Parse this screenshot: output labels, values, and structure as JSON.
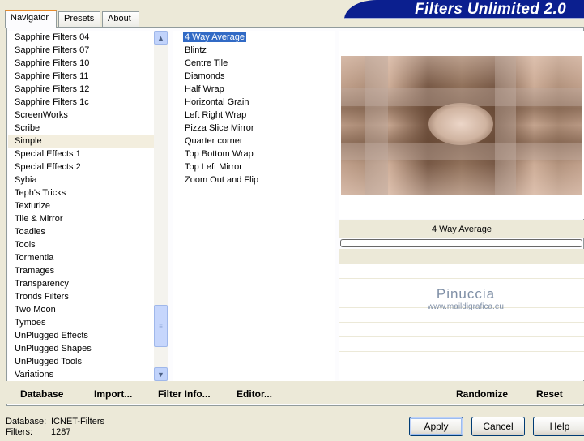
{
  "tabs": [
    "Navigator",
    "Presets",
    "About"
  ],
  "app_title": "Filters Unlimited 2.0",
  "categories": [
    "Sapphire Filters 04",
    "Sapphire Filters 07",
    "Sapphire Filters 10",
    "Sapphire Filters 11",
    "Sapphire Filters 12",
    "Sapphire Filters 1c",
    "ScreenWorks",
    "Scribe",
    "Simple",
    "Special Effects 1",
    "Special Effects 2",
    "Sybia",
    "Teph's Tricks",
    "Texturize",
    "Tile & Mirror",
    "Toadies",
    "Tools",
    "Tormentia",
    "Tramages",
    "Transparency",
    "Tronds Filters",
    "Two Moon",
    "Tymoes",
    "UnPlugged Effects",
    "UnPlugged Shapes",
    "UnPlugged Tools",
    "Variations"
  ],
  "selected_category": "Simple",
  "filters": [
    "4 Way Average",
    "Blintz",
    "Centre Tile",
    "Diamonds",
    "Half Wrap",
    "Horizontal Grain",
    "Left Right Wrap",
    "Pizza Slice Mirror",
    "Quarter corner",
    "Top Bottom Wrap",
    "Top Left Mirror",
    "Zoom Out and Flip"
  ],
  "selected_filter": "4 Way Average",
  "filter_name": "4 Way Average",
  "progress": 0,
  "watermark": {
    "name": "Pinuccia",
    "url": "www.maildigrafica.eu"
  },
  "links": {
    "database": "Database",
    "import": "Import...",
    "filter_info": "Filter Info...",
    "editor": "Editor...",
    "randomize": "Randomize",
    "reset": "Reset"
  },
  "status": {
    "database_label": "Database:",
    "database_value": "ICNET-Filters",
    "filters_label": "Filters:",
    "filters_value": "1287"
  },
  "buttons": {
    "apply": "Apply",
    "cancel": "Cancel",
    "help": "Help"
  },
  "colors": {
    "banner": "#0b1f8f",
    "selection": "#316ac5",
    "accent_tab": "#e68b2c"
  }
}
